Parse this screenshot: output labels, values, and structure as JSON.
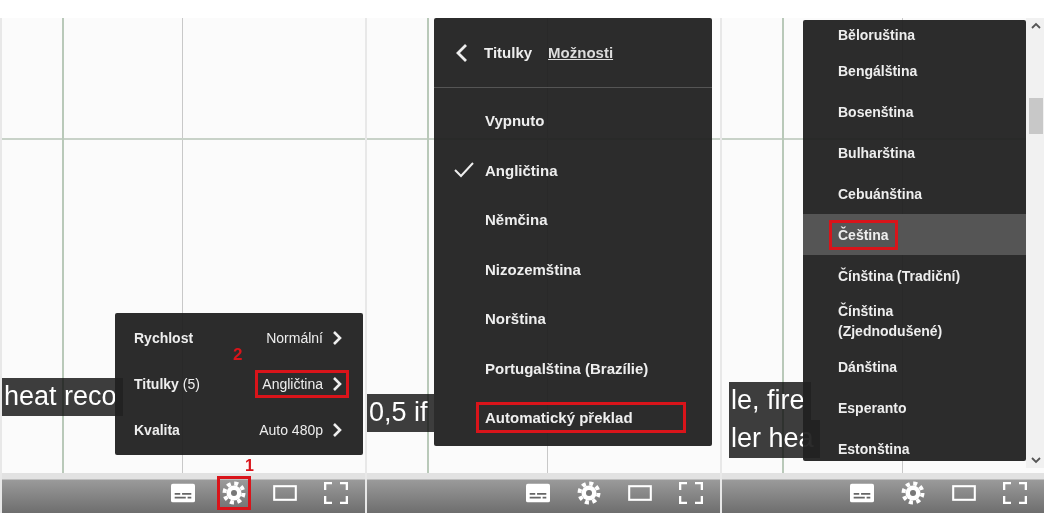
{
  "panels": [
    {
      "kind": "settings",
      "captions": [
        {
          "text": "heat reco"
        }
      ],
      "menu": {
        "rows": [
          {
            "label": "Rychlost",
            "value": "Normální",
            "highlighted": false
          },
          {
            "label": "Titulky",
            "count": "(5)",
            "value": "Angličtina",
            "highlighted": true,
            "marker": "2"
          },
          {
            "label": "Kvalita",
            "value": "Auto 480p",
            "highlighted": false
          }
        ]
      },
      "controls": [
        {
          "kind": "subtitles",
          "highlighted": false
        },
        {
          "kind": "settings",
          "highlighted": true,
          "marker": "1"
        },
        {
          "kind": "theater",
          "highlighted": false
        },
        {
          "kind": "fullscreen",
          "highlighted": false
        }
      ]
    },
    {
      "kind": "list",
      "captions": [
        {
          "text": "0,5 if"
        }
      ],
      "menu": {
        "back_title": "Titulky",
        "options_link": "Možnosti",
        "items": [
          {
            "label": "Vypnuto",
            "selected": false,
            "highlighted": false
          },
          {
            "label": "Angličtina",
            "selected": true,
            "highlighted": false
          },
          {
            "label": "Němčina",
            "selected": false,
            "highlighted": false
          },
          {
            "label": "Nizozemština",
            "selected": false,
            "highlighted": false
          },
          {
            "label": "Norština",
            "selected": false,
            "highlighted": false
          },
          {
            "label": "Portugalština (Brazílie)",
            "selected": false,
            "highlighted": false
          },
          {
            "label": "Automatický překlad",
            "selected": false,
            "highlighted": true
          }
        ]
      },
      "controls": [
        {
          "kind": "subtitles",
          "highlighted": false
        },
        {
          "kind": "settings",
          "highlighted": false
        },
        {
          "kind": "theater",
          "highlighted": false
        },
        {
          "kind": "fullscreen",
          "highlighted": false
        }
      ]
    },
    {
      "kind": "scroll_list",
      "captions": [
        {
          "text": "le, fire"
        },
        {
          "text": "ler hea"
        }
      ],
      "menu": {
        "items": [
          {
            "label": "Běloruština",
            "selected": false,
            "highlighted": false
          },
          {
            "label": "Bengálština",
            "selected": false,
            "highlighted": false
          },
          {
            "label": "Bosenština",
            "selected": false,
            "highlighted": false
          },
          {
            "label": "Bulharština",
            "selected": false,
            "highlighted": false
          },
          {
            "label": "Cebuánština",
            "selected": false,
            "highlighted": false
          },
          {
            "label": "Čeština",
            "selected": true,
            "highlighted": true
          },
          {
            "label": "Čínština (Tradiční)",
            "selected": false,
            "highlighted": false
          },
          {
            "label": "Čínština (Zjednodušené)",
            "selected": false,
            "highlighted": false
          },
          {
            "label": "Dánština",
            "selected": false,
            "highlighted": false
          },
          {
            "label": "Esperanto",
            "selected": false,
            "highlighted": false
          },
          {
            "label": "Estonština",
            "selected": false,
            "highlighted": false
          }
        ]
      },
      "controls": [
        {
          "kind": "subtitles",
          "highlighted": false
        },
        {
          "kind": "settings",
          "highlighted": false
        },
        {
          "kind": "theater",
          "highlighted": false
        },
        {
          "kind": "fullscreen",
          "highlighted": false
        }
      ]
    }
  ]
}
